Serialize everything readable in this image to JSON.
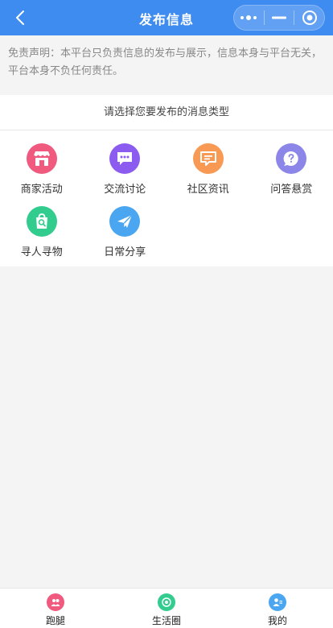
{
  "navbar": {
    "title": "发布信息",
    "back_icon": "chevron-left-icon",
    "capsule": {
      "more_icon": "more-dots-icon",
      "minimize_icon": "minus-icon",
      "close_icon": "target-icon"
    },
    "background_color": "#3f8cf0"
  },
  "disclaimer": {
    "text": "免责声明：本平台只负责信息的发布与展示，信息本身与平台无关，平台本身不负任何责任。"
  },
  "panel": {
    "title": "请选择您要发布的消息类型",
    "categories": [
      {
        "label": "商家活动",
        "icon": "store-icon",
        "color": "#ef5a7e"
      },
      {
        "label": "交流讨论",
        "icon": "chat-bubble-icon",
        "color": "#8c5cf0"
      },
      {
        "label": "社区资讯",
        "icon": "news-bubble-icon",
        "color": "#f89a54"
      },
      {
        "label": "问答悬赏",
        "icon": "question-icon",
        "color": "#8b86e8"
      },
      {
        "label": "寻人寻物",
        "icon": "search-bag-icon",
        "color": "#33cc8f"
      },
      {
        "label": "日常分享",
        "icon": "paper-plane-icon",
        "color": "#4aa6f0"
      }
    ]
  },
  "tabbar": {
    "items": [
      {
        "label": "跑腿",
        "icon": "errand-icon",
        "color": "#ef5a7e"
      },
      {
        "label": "生活圈",
        "icon": "life-circle-icon",
        "color": "#33cc8f"
      },
      {
        "label": "我的",
        "icon": "profile-icon",
        "color": "#4aa6f0"
      }
    ]
  }
}
